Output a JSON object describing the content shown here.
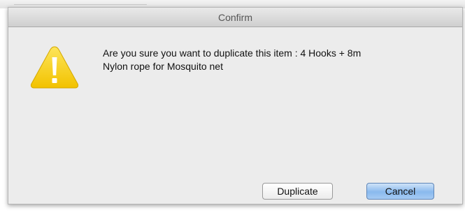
{
  "dialog": {
    "title": "Confirm",
    "message_line1": "Are you sure you want to duplicate this item : 4 Hooks + 8m",
    "message_line2": "Nylon rope for Mosquito net",
    "icon": "warning-icon",
    "buttons": {
      "duplicate_label": "Duplicate",
      "cancel_label": "Cancel"
    }
  },
  "colors": {
    "dialog_background": "#ececec",
    "icon_fill": "#f7cd1a",
    "default_button": "#89b9ee"
  }
}
